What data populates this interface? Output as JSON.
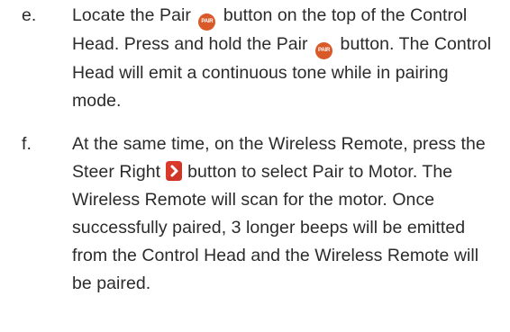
{
  "steps": [
    {
      "marker": "e.",
      "segments": [
        "Locate the Pair",
        "button on the top of the Control Head. Press and hold the Pair",
        "button. The Control Head will emit a continuous tone while in pairing mode."
      ]
    },
    {
      "marker": "f.",
      "segments": [
        "At the same time, on the Wireless Remote, press the Steer Right",
        "button to select Pair to Motor. The Wireless Remote will scan for the motor. Once successfully paired, 3 longer beeps will be emitted from the Control Head and the Wireless Remote will be paired."
      ]
    }
  ],
  "icons": {
    "pair_label": "PAIR",
    "pair_color": "#d95a28",
    "steer_right_color": "#d93a2a"
  }
}
